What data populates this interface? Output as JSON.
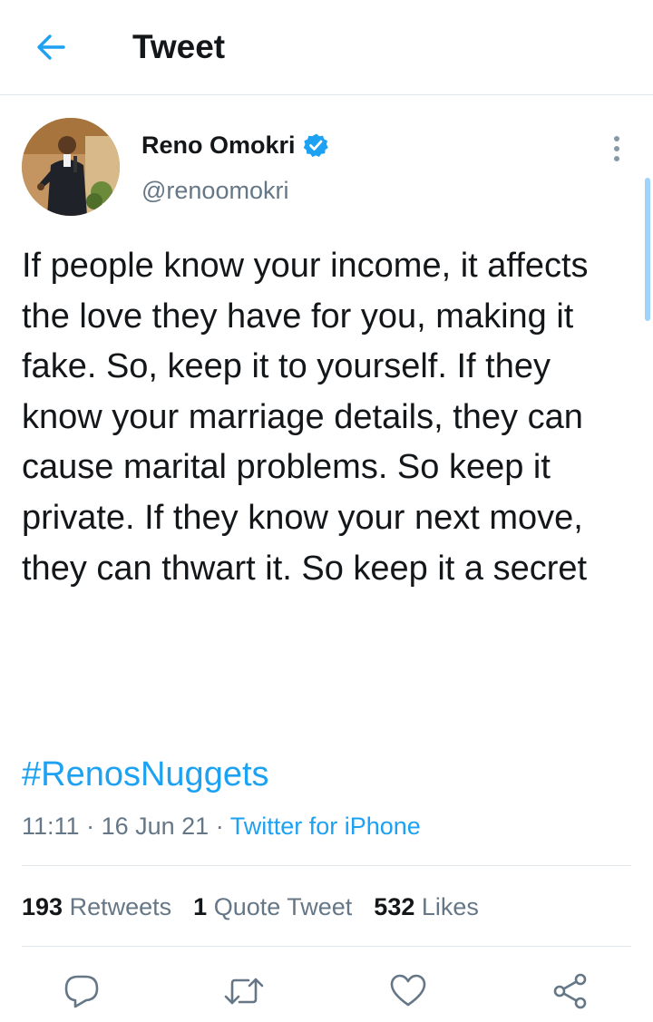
{
  "header": {
    "title": "Tweet",
    "back_icon": "arrow-left-icon"
  },
  "colors": {
    "accent": "#1da1f2",
    "text": "#14171a",
    "secondary": "#657786",
    "divider": "#e1e8ed"
  },
  "author": {
    "name": "Reno Omokri",
    "handle": "@renoomokri",
    "verified": true
  },
  "tweet": {
    "text": "If people know your income, it affects the love they have for you, making it fake. So, keep it to yourself. If they know your marriage details, they can cause marital problems. So keep it private. If they know your next move, they can thwart it. So keep it a secret",
    "hashtag": "#RenosNuggets",
    "time": "11:11",
    "date": "16 Jun 21",
    "source": "Twitter for iPhone",
    "separator": "·"
  },
  "stats": {
    "retweets": {
      "count": "193",
      "label": "Retweets"
    },
    "quotes": {
      "count": "1",
      "label": "Quote Tweet"
    },
    "likes": {
      "count": "532",
      "label": "Likes"
    }
  },
  "actions": [
    "reply-icon",
    "retweet-icon",
    "like-icon",
    "share-icon"
  ]
}
